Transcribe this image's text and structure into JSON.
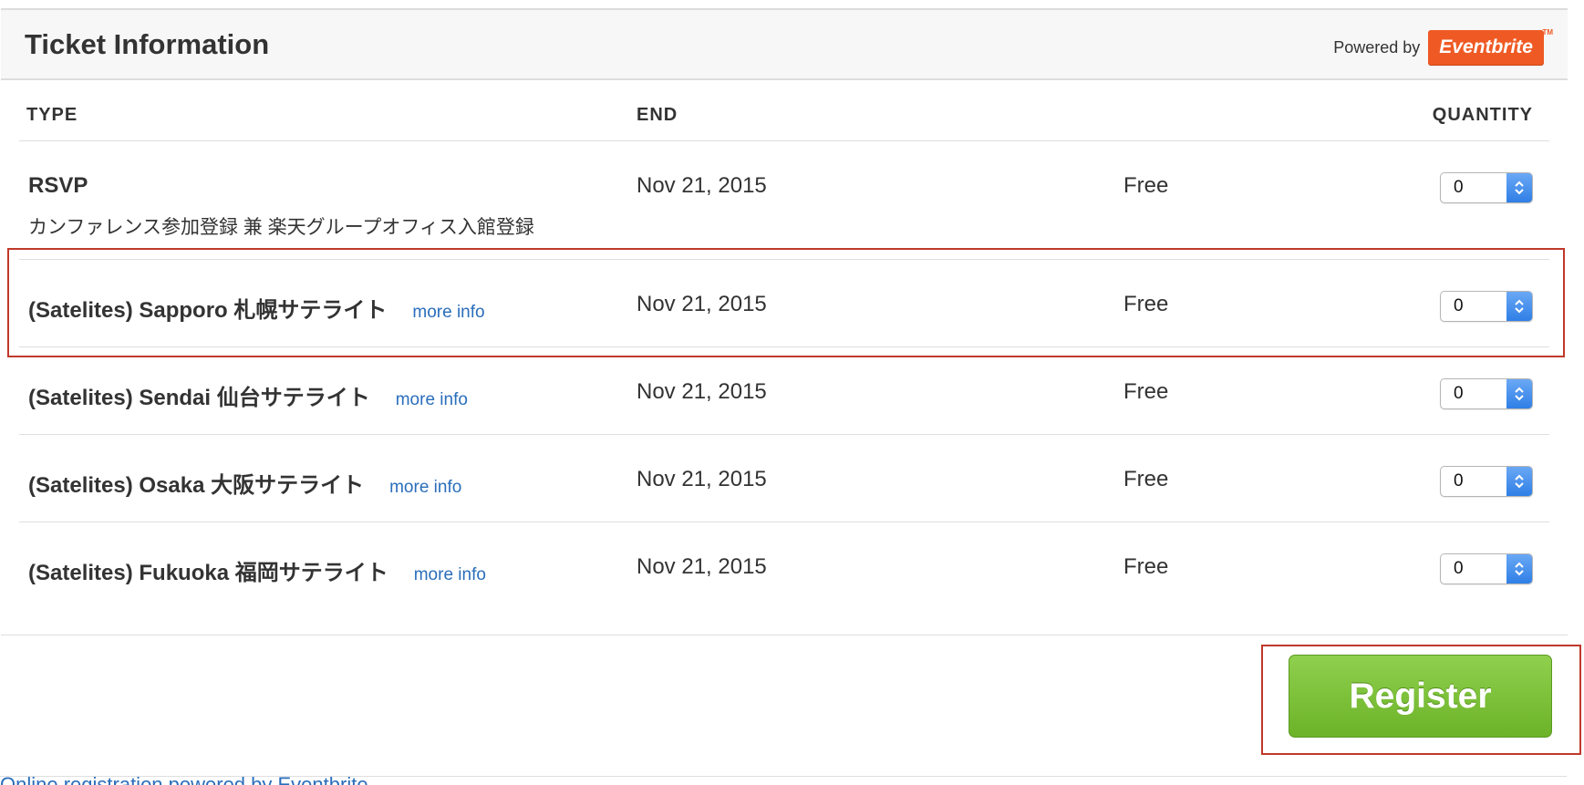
{
  "header": {
    "title": "Ticket Information",
    "powered_by": "Powered by",
    "brand": "Eventbrite",
    "brand_tm": "TM"
  },
  "columns": {
    "type": "TYPE",
    "end": "END",
    "quantity": "QUANTITY"
  },
  "tickets": [
    {
      "name": "RSVP",
      "subtitle": "カンファレンス参加登録 兼 楽天グループオフィス入館登録",
      "more_info": "",
      "end": "Nov 21, 2015",
      "price": "Free",
      "quantity": "0"
    },
    {
      "name": "(Satelites) Sapporo 札幌サテライト",
      "subtitle": "",
      "more_info": "more info",
      "end": "Nov 21, 2015",
      "price": "Free",
      "quantity": "0"
    },
    {
      "name": "(Satelites) Sendai 仙台サテライト",
      "subtitle": "",
      "more_info": "more info",
      "end": "Nov 21, 2015",
      "price": "Free",
      "quantity": "0"
    },
    {
      "name": "(Satelites) Osaka 大阪サテライト",
      "subtitle": "",
      "more_info": "more info",
      "end": "Nov 21, 2015",
      "price": "Free",
      "quantity": "0"
    },
    {
      "name": "(Satelites) Fukuoka 福岡サテライト",
      "subtitle": "",
      "more_info": "more info",
      "end": "Nov 21, 2015",
      "price": "Free",
      "quantity": "0"
    }
  ],
  "register_label": "Register",
  "footer_text": "Online registration powered by Eventbrite",
  "colors": {
    "brand": "#ef5a24",
    "link": "#2a6ebb",
    "register": "#7cc23a",
    "highlight": "#c0392b",
    "stepper": "#2f7fe6"
  },
  "icons": {
    "stepper": "chevron-up-down-icon"
  }
}
